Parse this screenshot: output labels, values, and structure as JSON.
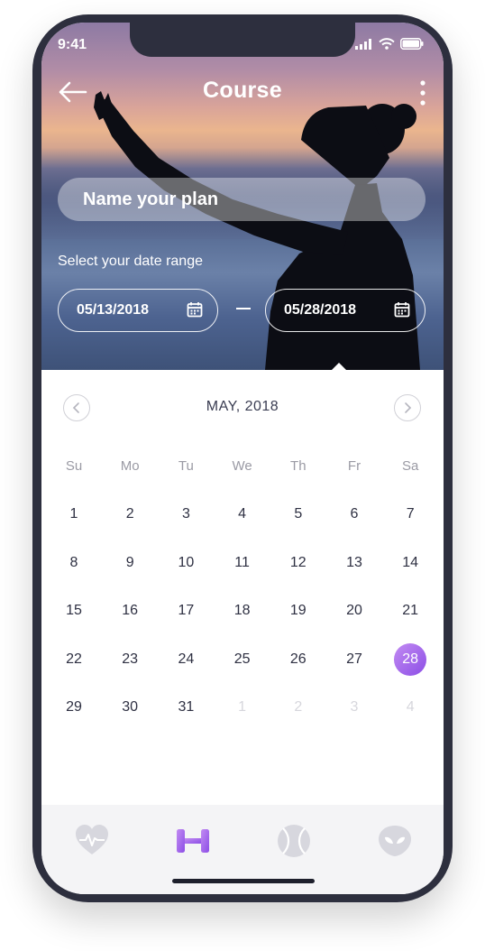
{
  "status_bar": {
    "time": "9:41"
  },
  "header": {
    "title": "Course"
  },
  "plan": {
    "placeholder": "Name your plan"
  },
  "date_range": {
    "label": "Select your date range",
    "start": "05/13/2018",
    "end": "05/28/2018"
  },
  "calendar": {
    "month_title": "MAY, 2018",
    "weekdays": [
      "Su",
      "Mo",
      "Tu",
      "We",
      "Th",
      "Fr",
      "Sa"
    ],
    "weeks": [
      [
        "1",
        "2",
        "3",
        "4",
        "5",
        "6",
        "7"
      ],
      [
        "8",
        "9",
        "10",
        "11",
        "12",
        "13",
        "14"
      ],
      [
        "15",
        "16",
        "17",
        "18",
        "19",
        "20",
        "21"
      ],
      [
        "22",
        "23",
        "24",
        "25",
        "26",
        "27",
        "28"
      ],
      [
        "29",
        "30",
        "31",
        "1",
        "2",
        "3",
        "4"
      ]
    ],
    "selected_day": "28",
    "accent_color": "#9b5ff0"
  },
  "tabbar": {
    "items": [
      {
        "icon": "heart-pulse-icon",
        "active": false
      },
      {
        "icon": "dumbbell-icon",
        "active": true
      },
      {
        "icon": "tennis-ball-icon",
        "active": false
      },
      {
        "icon": "alien-icon",
        "active": false
      }
    ]
  }
}
